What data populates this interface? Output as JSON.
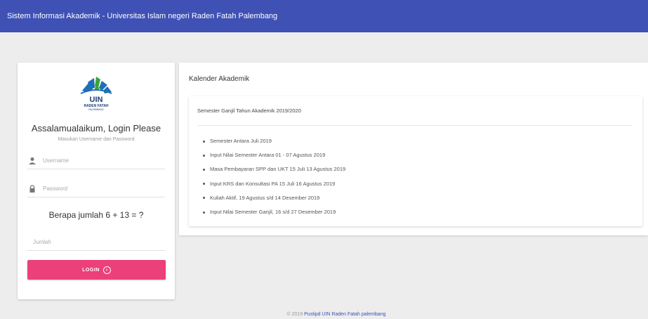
{
  "topbar": {
    "title": "Sistem Informasi Akademik - Universitas Islam negeri Raden Fatah Palembang"
  },
  "login": {
    "logo": {
      "text": "UIN",
      "sub1": "RADEN FATAH",
      "sub2": "PALEMBANG"
    },
    "title": "Assalamualaikum, Login Please",
    "subtitle": "Masukan Username dan Password",
    "username": {
      "placeholder": "Username",
      "value": "",
      "icon": "person-icon"
    },
    "password": {
      "placeholder": "Password",
      "value": "",
      "icon": "lock-icon"
    },
    "captcha": "Berapa jumlah 6 + 13 = ?",
    "jumlah": {
      "placeholder": "Jumlah",
      "value": ""
    },
    "button": {
      "label": "LOGIN",
      "icon": "arrow-circle-right-icon"
    }
  },
  "calendar": {
    "title": "Kalender Akademik",
    "semester": "Semester Ganjil Tahun Akademik 2019/2020",
    "items": [
      "Semester Antara Juli 2019",
      "Input Nilai Semester Antara 01 - 07 Agustus 2019",
      "Masa Pembayaran SPP dan UKT 15 Juli 13 Agustus 2019",
      "Input KRS dan Konsultasi PA 15 Juli 16 Agustus 2019",
      "Kuliah Aktif, 19 Agustus s/d 14 Desember 2019",
      "Input Nilai Semester Ganjil, 16 s/d 27 Desember 2019"
    ]
  },
  "footer": {
    "prefix": "© 2019",
    "link": "Pustipd UIN Raden Fatah palembang"
  },
  "colors": {
    "header": "#3f51b5",
    "button": "#ec407a",
    "logo_blue": "#1e6fb7",
    "logo_green": "#3aa33a",
    "background": "#ededed"
  }
}
